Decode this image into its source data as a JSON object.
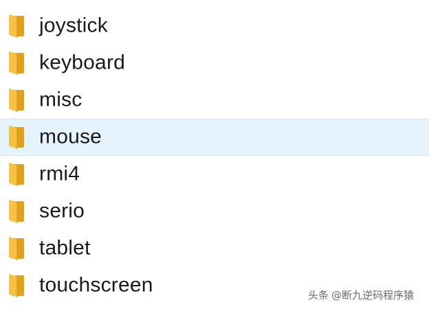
{
  "folders": [
    {
      "name": "joystick",
      "icon": "folder-icon",
      "selected": false
    },
    {
      "name": "keyboard",
      "icon": "folder-icon",
      "selected": false
    },
    {
      "name": "misc",
      "icon": "folder-icon",
      "selected": false
    },
    {
      "name": "mouse",
      "icon": "folder-icon",
      "selected": true
    },
    {
      "name": "rmi4",
      "icon": "folder-icon",
      "selected": false
    },
    {
      "name": "serio",
      "icon": "folder-icon",
      "selected": false
    },
    {
      "name": "tablet",
      "icon": "folder-icon",
      "selected": false
    },
    {
      "name": "touchscreen",
      "icon": "folder-icon",
      "selected": false
    }
  ],
  "watermark": {
    "source": "头条",
    "handle": "@断九逆码程序猿"
  },
  "colors": {
    "selection_background": "#e5f3ff",
    "folder_front": "#f5c242",
    "folder_back": "#e0a21c",
    "text": "#1a1a1a"
  }
}
